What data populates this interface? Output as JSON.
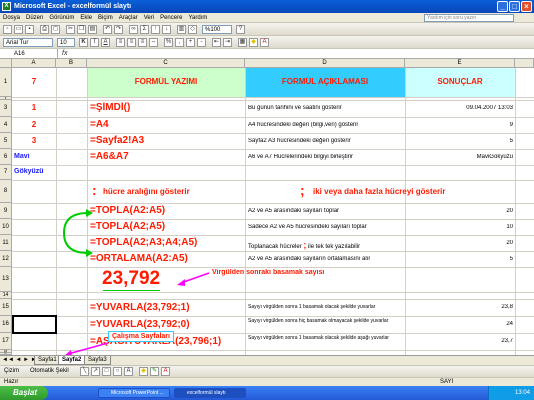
{
  "window": {
    "title": "Microsoft Excel - excelformül slaytı",
    "minimize": "_",
    "restore": "□",
    "close": "×"
  },
  "menu": {
    "items": [
      "Dosya",
      "Düzen",
      "Görünüm",
      "Ekle",
      "Biçim",
      "Araçlar",
      "Veri",
      "Pencere",
      "Yardım"
    ],
    "help_placeholder": "Yardım için soru yazın"
  },
  "toolbar": {
    "zoom": "%100",
    "font_name": "Arial Tur",
    "font_size": "10"
  },
  "formula_bar": {
    "name_box": "A16",
    "fx": "fx"
  },
  "columns": [
    "A",
    "B",
    "C",
    "D",
    "E"
  ],
  "rows": [
    "1",
    "2",
    "3",
    "4",
    "5",
    "6",
    "7",
    "8",
    "9",
    "10",
    "11",
    "12",
    "13",
    "14",
    "15",
    "16",
    "17",
    "18",
    "19",
    "20"
  ],
  "sheet": {
    "header": {
      "col_a": "7",
      "col_c": "FORMÜL YAZIMI",
      "col_d": "FORMÜL AÇIKLAMASI",
      "col_e": "SONUÇLAR"
    },
    "row3": {
      "num": "1",
      "formula": "=ŞİMDİ()",
      "desc": "Bu günün tarihini ve saatini gösterir",
      "result": "09.04.2007 13:03"
    },
    "row4": {
      "num": "2",
      "formula": "=A4",
      "desc": "A4 hücresindeki değeri (bilgi,veri) gösterir",
      "result": "9"
    },
    "row5": {
      "num": "3",
      "formula": "=Sayfa2!A3",
      "desc": "Sayfa2 A3 hücresindeki değeri gösterir",
      "result": "5"
    },
    "row6": {
      "a": "Mavi",
      "formula": "=A6&A7",
      "desc": "A6 ve A7 Hücrelerindeki bilgiyi birleştirir",
      "result": "MaviGökyüzü"
    },
    "row7": {
      "a": "Gökyüzü"
    },
    "notes": {
      "colon_sym": ":",
      "colon_text": "hücre aralığını gösterir",
      "semicolon_sym": ";",
      "semicolon_text": "iki veya daha fazla hücreyi gösterir"
    },
    "row9": {
      "formula": "=TOPLA(A2:A5)",
      "desc": "A2 ve A5 arasındaki sayıları toplar",
      "result": "20"
    },
    "row10": {
      "formula": "=TOPLA(A2;A5)",
      "desc": "Sadece A2 ve A5 hücresindeki sayıları toplar",
      "result": "10"
    },
    "row11": {
      "formula": "=TOPLA(A2;A3;A4;A5)",
      "desc_a": "Toplanacak hücreler",
      "desc_sym": ";",
      "desc_b": "ile tek tek yazılabilir",
      "result": "20"
    },
    "row12": {
      "formula": "=ORTALAMA(A2:A5)",
      "desc": "A2 ve A5 arasındaki sayıların ortalamasını alır",
      "result": "5"
    },
    "big_number": "23,792",
    "big_number_note": "Virgülden sonraki basamak sayısı",
    "row15": {
      "formula": "=YUVARLA(23,792;1)",
      "desc": "Sayıyı virgülden sonra 1 basamak olacak şekilde yuvarlar",
      "result": "23,8"
    },
    "row16": {
      "formula": "=YUVARLA(23,792;0)",
      "desc": "Sayıyı virgülden sonra hiç basamak olmayacak şekilde yuvarlar",
      "result": "24"
    },
    "row17": {
      "formula": "=AŞAĞIYUVARLA(23,796;1)",
      "desc": "Sayıyı virgülden sonra 1 basamak olacak şekilde aşağı yuvarlar",
      "result": "23,7"
    },
    "sheets_note": "Çalışma Sayfaları"
  },
  "tabs": [
    "Sayfa1",
    "Sayfa2",
    "Sayfa3"
  ],
  "draw_bar": {
    "draw": "Çizim",
    "autoshapes": "Otomatik Şekil"
  },
  "status": {
    "left": "Hazır",
    "right": "SAYI"
  },
  "taskbar": {
    "start": "Başlat",
    "tasks": [
      "Microsoft PowerPoint ...",
      "excelformül slaytı"
    ],
    "time": "13:04"
  },
  "colors": {
    "header_fill": "#ccffcc",
    "header_desc_fill": "#33ccff",
    "header_result_fill": "#ccffff",
    "accent_red": "#ff1a00",
    "arrow_green": "#00cc00",
    "arrow_magenta": "#ff00ff"
  }
}
